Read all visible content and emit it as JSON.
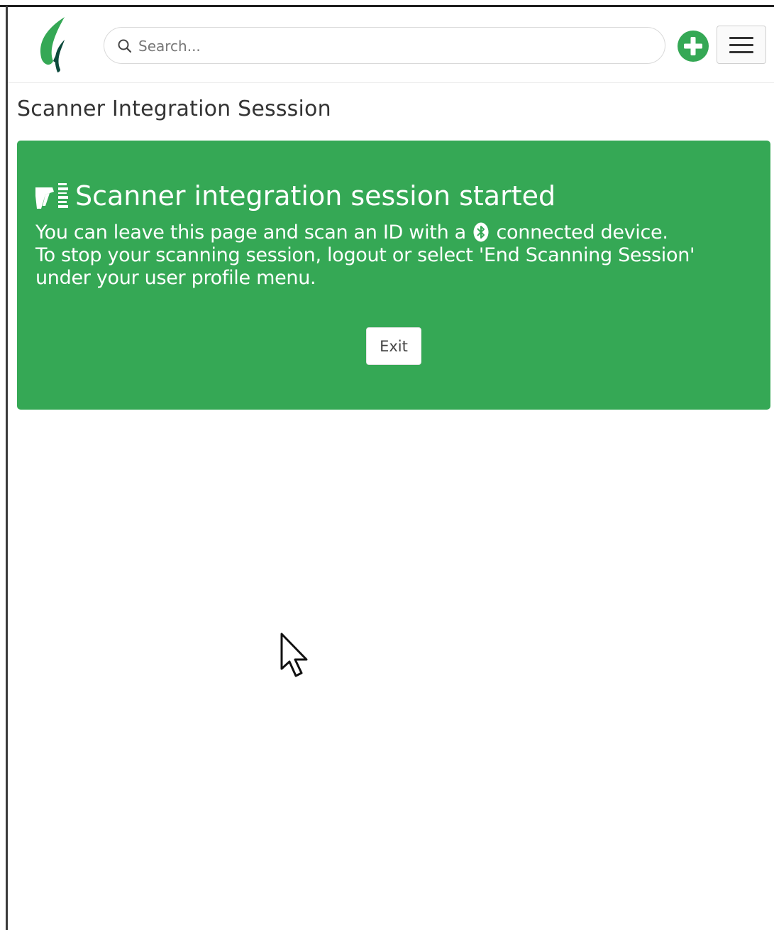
{
  "header": {
    "search": {
      "placeholder": "Search..."
    }
  },
  "page": {
    "title": "Scanner Integration Sesssion"
  },
  "alert": {
    "heading": "Scanner integration session started",
    "line1_before": "You can leave this page and scan an ID with a",
    "line1_after": "connected device.",
    "line2": "To stop your scanning session, logout or select 'End Scanning Session'",
    "line3": "under your user profile menu.",
    "exit_label": "Exit"
  },
  "colors": {
    "brand_green": "#35a855",
    "logo_dark": "#0d4a3c"
  },
  "icons": {
    "logo": "leaf-logo-icon",
    "search": "search-icon",
    "add": "plus-circle-icon",
    "menu": "hamburger-menu-icon",
    "scanner": "barcode-scanner-icon",
    "bluetooth": "bluetooth-icon",
    "cursor": "mouse-pointer-icon"
  }
}
